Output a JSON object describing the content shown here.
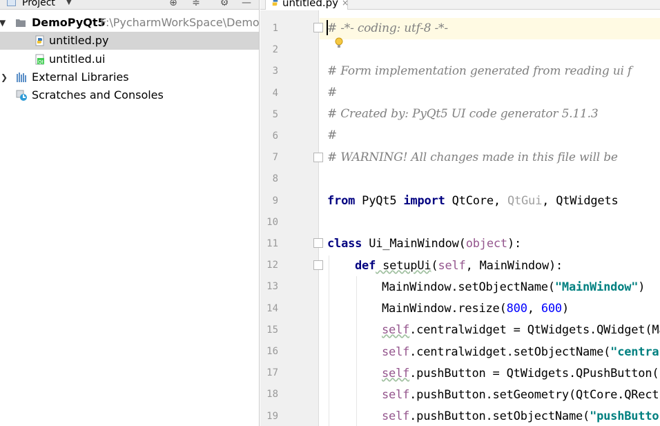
{
  "project_panel": {
    "title": "Project",
    "tree": [
      {
        "label": "DemoPyQt5",
        "path": "F:\\PycharmWorkSpace\\DemoPy",
        "icon": "folder-icon",
        "expanded": true
      },
      {
        "label": "untitled.py",
        "icon": "python-file-icon",
        "selected": true
      },
      {
        "label": "untitled.ui",
        "icon": "qt-file-icon"
      },
      {
        "label": "External Libraries",
        "icon": "library-icon",
        "expanded": false
      },
      {
        "label": "Scratches and Consoles",
        "icon": "scratches-icon"
      }
    ]
  },
  "editor": {
    "tab": {
      "label": "untitled.py",
      "close": "×"
    },
    "line_numbers": [
      "1",
      "2",
      "3",
      "4",
      "5",
      "6",
      "7",
      "8",
      "9",
      "10",
      "11",
      "12",
      "13",
      "14",
      "15",
      "16",
      "17",
      "18",
      "19"
    ],
    "lines": {
      "l1": "# -*- coding: utf-8 -*-",
      "l3": "# Form implementation generated from reading ui f",
      "l4": "#",
      "l5": "# Created by: PyQt5 UI code generator 5.11.3",
      "l6": "#",
      "l7": "# WARNING! All changes made in this file will be",
      "l9": {
        "from": "from",
        "mod": " PyQt5 ",
        "import": "import",
        "a": " QtCore, ",
        "b": "QtGui",
        "c": ", QtWidgets"
      },
      "l11": {
        "class": "class",
        "name": " Ui_MainWindow(",
        "base": "object",
        "end": "):"
      },
      "l12": {
        "def": "def",
        "name": " setupUi",
        "open": "(",
        "self": "self",
        "rest": ", MainWindow):"
      },
      "l13": {
        "a": "MainWindow.setObjectName(",
        "s": "\"MainWindow\"",
        "b": ")"
      },
      "l14": {
        "a": "MainWindow.resize(",
        "n1": "800",
        "c": ", ",
        "n2": "600",
        "b": ")"
      },
      "l15": {
        "self": "self",
        "rest": ".centralwidget = QtWidgets.QWidget(Ma"
      },
      "l16": {
        "self": "self",
        "rest": ".centralwidget.setObjectName(",
        "s": "\"centra"
      },
      "l17": {
        "self": "self",
        "rest": ".pushButton = QtWidgets.QPushButton(s"
      },
      "l18": {
        "self": "self",
        "rest": ".pushButton.setGeometry(QtCore.QRect"
      },
      "l19": {
        "self": "self",
        "rest": ".pushButton.setObjectName(",
        "s": "\"pushButto"
      }
    }
  }
}
